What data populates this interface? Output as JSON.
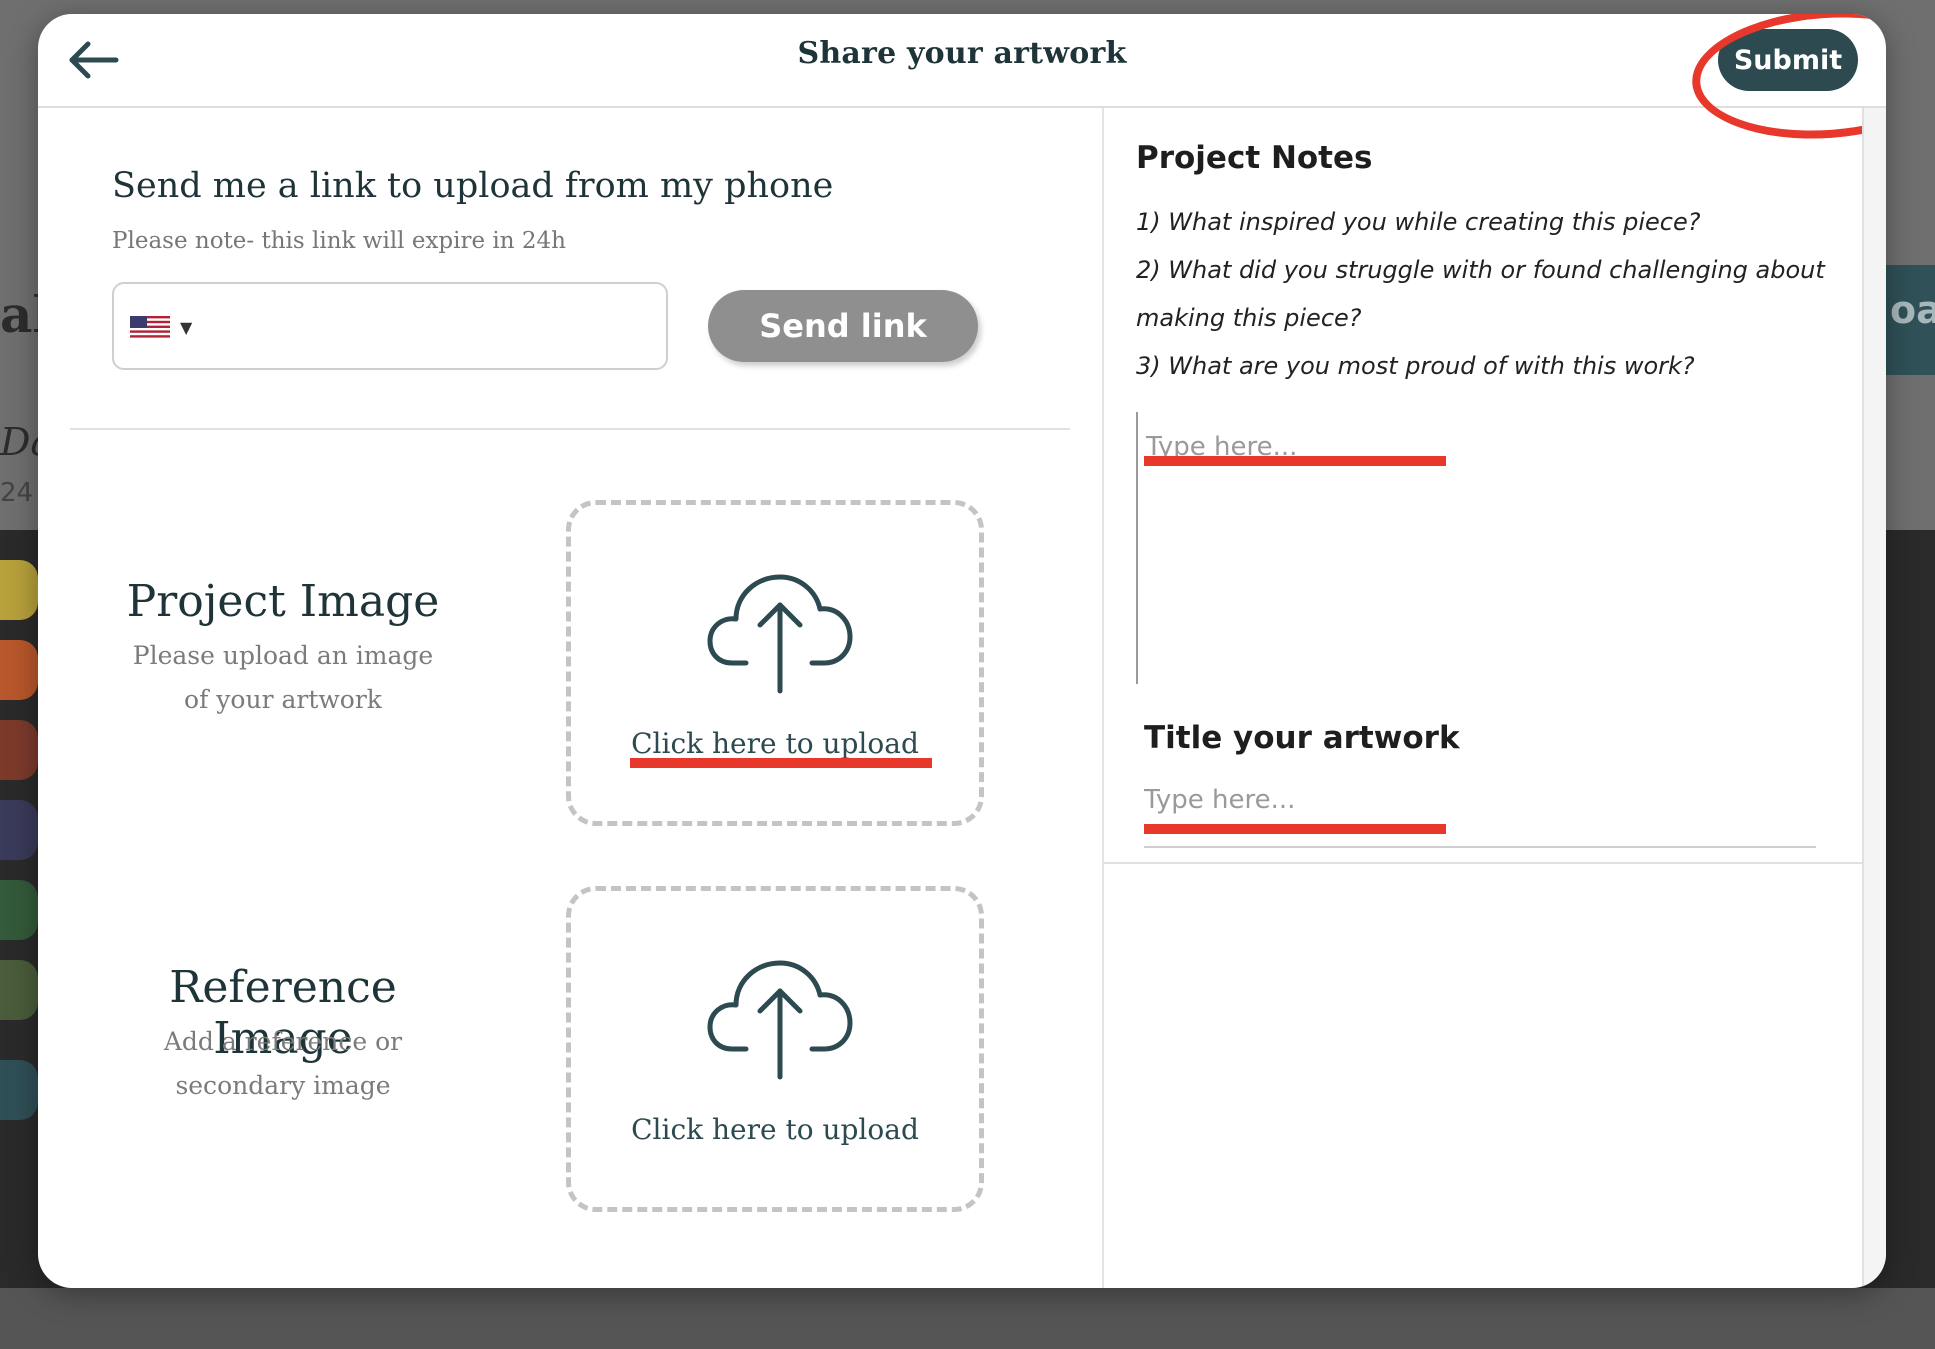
{
  "background": {
    "left_title_fragment": "al",
    "left_italic_fragment": "Da",
    "left_date_fragment": "24",
    "right_button_fragment": "oa"
  },
  "header": {
    "back_label": "←",
    "title": "Share your artwork",
    "submit_label": "Submit"
  },
  "phone_link": {
    "heading": "Send me a link to upload from my phone",
    "note": "Please note- this link will expire in 24h",
    "country": "US",
    "phone_value": "",
    "send_label": "Send link"
  },
  "project_image": {
    "title": "Project Image",
    "subtitle": "Please upload an image of your artwork",
    "upload_label": "Click here to upload"
  },
  "reference_image": {
    "title": "Reference Image",
    "subtitle": "Add a reference or secondary image",
    "upload_label": "Click here to upload"
  },
  "notes": {
    "heading": "Project Notes",
    "q1": "1) What inspired you while creating this piece?",
    "q2": "2) What did you struggle with or found challenging about making this piece?",
    "q3": "3) What are you most proud of with this work?",
    "placeholder": "Type here..."
  },
  "title_field": {
    "heading": "Title your artwork",
    "placeholder": "Type here..."
  },
  "colors": {
    "accent": "#2c4a50",
    "annotation_red": "#e8382b",
    "disabled_button": "#8f8f8f"
  }
}
